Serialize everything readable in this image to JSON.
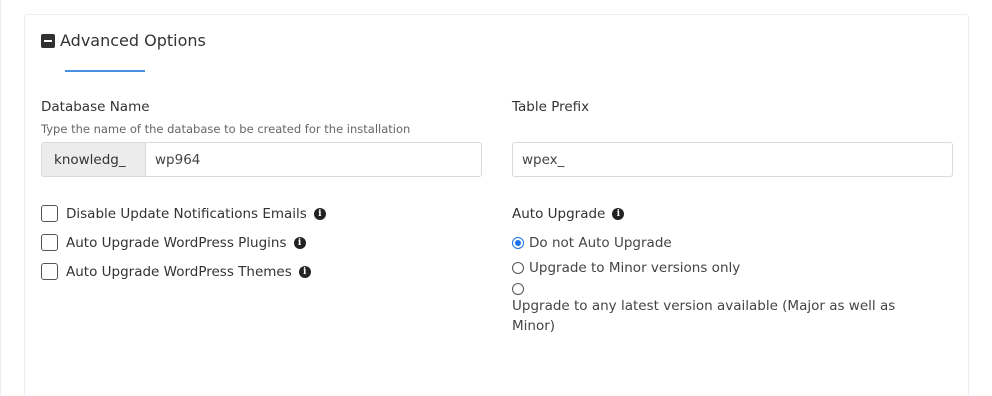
{
  "section": {
    "title": "Advanced Options",
    "toggle_icon": "minus-square-icon"
  },
  "database": {
    "label": "Database Name",
    "hint": "Type the name of the database to be created for the installation",
    "prefix": "knowledg_",
    "value": "wp964"
  },
  "table_prefix": {
    "label": "Table Prefix",
    "value": "wpex_"
  },
  "checkboxes": [
    {
      "label": "Disable Update Notifications Emails",
      "checked": false
    },
    {
      "label": "Auto Upgrade WordPress Plugins",
      "checked": false
    },
    {
      "label": "Auto Upgrade WordPress Themes",
      "checked": false
    }
  ],
  "auto_upgrade": {
    "label": "Auto Upgrade",
    "options": [
      {
        "label": "Do not Auto Upgrade",
        "checked": true
      },
      {
        "label": "Upgrade to Minor versions only",
        "checked": false
      },
      {
        "label": "Upgrade to any latest version available (Major as well as Minor)",
        "checked": false
      }
    ]
  },
  "colors": {
    "accent": "#1a73e8",
    "underline": "#4a90e2"
  }
}
